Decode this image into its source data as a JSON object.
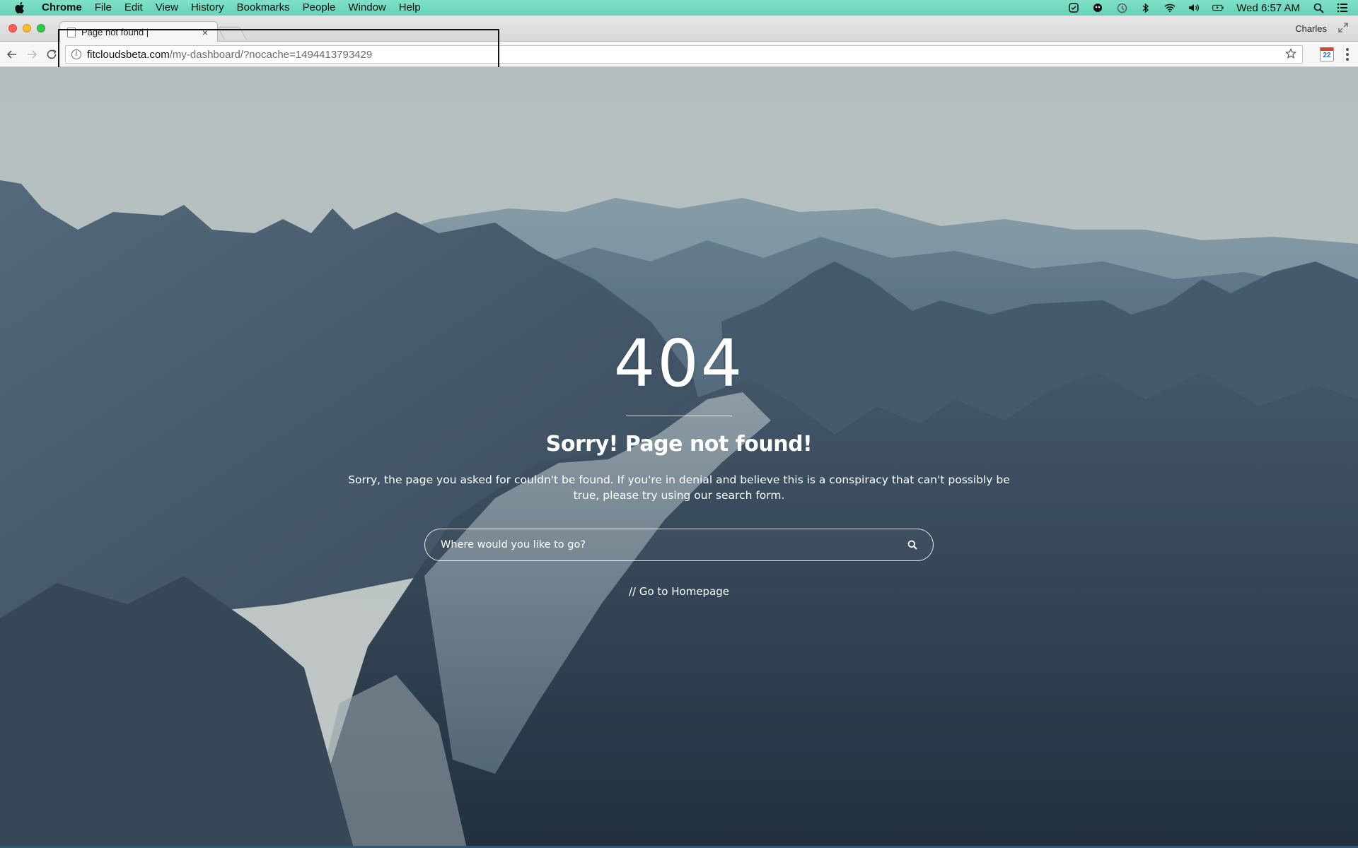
{
  "menubar": {
    "app_name": "Chrome",
    "items": [
      "File",
      "Edit",
      "View",
      "History",
      "Bookmarks",
      "People",
      "Window",
      "Help"
    ],
    "clock": "Wed 6:57 AM",
    "status_icons": [
      "task-icon",
      "alien-icon",
      "time-machine-icon",
      "bluetooth-icon",
      "wifi-icon",
      "volume-icon",
      "battery-icon",
      "spotlight-icon",
      "notification-center-icon"
    ]
  },
  "browser": {
    "tab": {
      "title": "Page not found |",
      "close_glyph": "×"
    },
    "profile_name": "Charles",
    "url": {
      "domain": "fitcloudsbeta.com",
      "path": "/my-dashboard/?nocache=1494413793429"
    },
    "extension_badge": "22"
  },
  "page": {
    "error_code": "404",
    "title": "Sorry! Page not found!",
    "message": "Sorry, the page you asked for couldn't be found. If you're in denial and believe this is a conspiracy that can't possibly be true, please try using our search form.",
    "search_placeholder": "Where would you like to go?",
    "home_link": "// Go to Homepage"
  },
  "colors": {
    "menubar": "#66d3b6",
    "sky": "#d2d9d8",
    "mountain_dark": "#2b3d4e"
  }
}
